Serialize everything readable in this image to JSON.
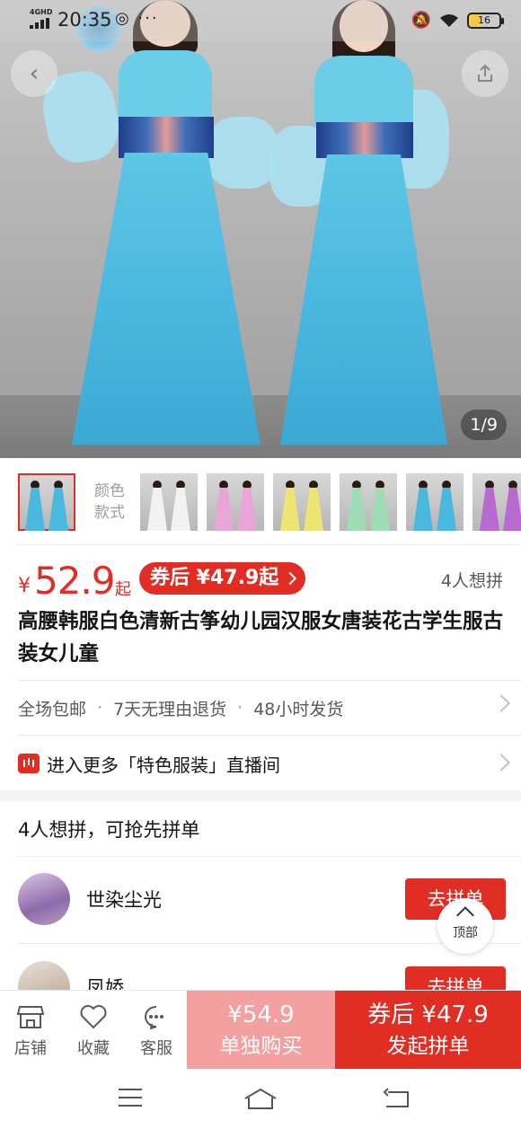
{
  "status_bar": {
    "network": "4GHD",
    "time": "20:35",
    "extra_icons": "◎ ···",
    "battery_level": "16"
  },
  "gallery": {
    "counter": "1/9"
  },
  "thumbnails": {
    "label": "颜色\n款式",
    "items": [
      {
        "color": "#4bb8de"
      },
      {
        "color": "#f2f2f2"
      },
      {
        "color": "#e6a6d6"
      },
      {
        "color": "#ece574"
      },
      {
        "color": "#9fdcb6"
      },
      {
        "color": "#4bb8de"
      },
      {
        "color": "#b86ad0"
      }
    ]
  },
  "price": {
    "currency": "¥",
    "value": "52.9",
    "suffix": "起",
    "coupon_label": "券后 ¥47.9起",
    "want_count": "4人想拼"
  },
  "product": {
    "title": "高腰韩服白色清新古筝幼儿园汉服女唐装花古学生服古装女儿童"
  },
  "services": {
    "item1": "全场包邮",
    "item2": "7天无理由退货",
    "item3": "48小时发货",
    "separator": "·"
  },
  "live": {
    "text": "进入更多「特色服装」直播间"
  },
  "group_buy": {
    "header": "4人想拼，可抢先拼单",
    "items": [
      {
        "name": "世染尘光",
        "button": "去拼单"
      },
      {
        "name": "凤娇",
        "button": "去拼单"
      }
    ]
  },
  "back_to_top": {
    "label": "顶部"
  },
  "bottom_bar": {
    "store": "店铺",
    "favorite": "收藏",
    "service": "客服",
    "solo_price": "¥54.9",
    "solo_label": "单独购买",
    "group_price": "券后 ¥47.9",
    "group_label": "发起拼单"
  },
  "colors": {
    "accent": "#e02e24",
    "solo_button": "#f4a0a0"
  }
}
